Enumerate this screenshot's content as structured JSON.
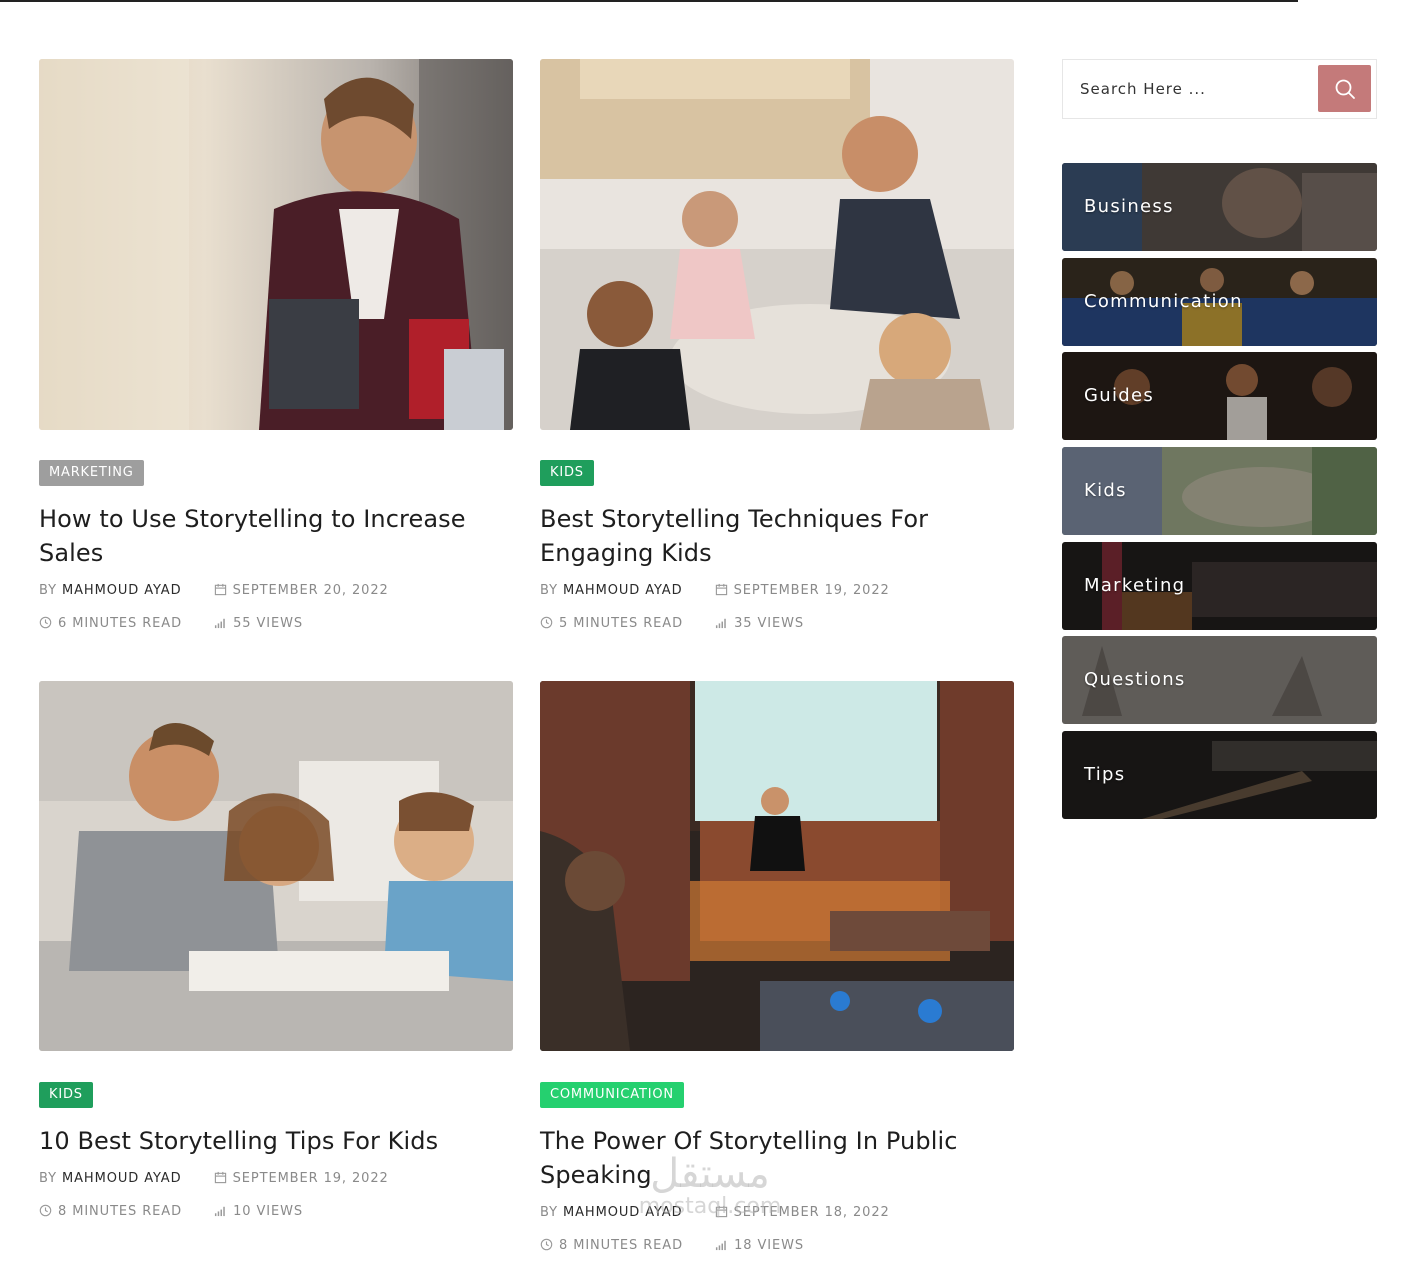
{
  "search": {
    "placeholder": "Search Here ..."
  },
  "colors": {
    "accent_search": "#c47a7a",
    "tag_marketing": "#9e9e9e",
    "tag_kids": "#1f9e5c",
    "tag_communication": "#25d06f"
  },
  "posts": [
    {
      "tag": "Marketing",
      "title": "How to Use Storytelling to Increase Sales",
      "author_prefix": "By",
      "author": "Mahmoud Ayad",
      "date": "September 20, 2022",
      "read_time": "6 Minutes Read",
      "views": "55 Views"
    },
    {
      "tag": "Kids",
      "title": "Best Storytelling Techniques For Engaging Kids",
      "author_prefix": "By",
      "author": "Mahmoud Ayad",
      "date": "September 19, 2022",
      "read_time": "5 Minutes Read",
      "views": "35 Views"
    },
    {
      "tag": "Kids",
      "title": "10 Best Storytelling Tips For Kids",
      "author_prefix": "By",
      "author": "Mahmoud Ayad",
      "date": "September 19, 2022",
      "read_time": "8 Minutes Read",
      "views": "10 Views"
    },
    {
      "tag": "Communication",
      "title": "The Power Of Storytelling In Public Speaking",
      "author_prefix": "By",
      "author": "Mahmoud Ayad",
      "date": "September 18, 2022",
      "read_time": "8 Minutes Read",
      "views": "18 Views"
    }
  ],
  "categories": [
    {
      "label": "Business"
    },
    {
      "label": "Communication"
    },
    {
      "label": "Guides"
    },
    {
      "label": "Kids"
    },
    {
      "label": "Marketing"
    },
    {
      "label": "Questions"
    },
    {
      "label": "Tips"
    }
  ],
  "watermark": {
    "arabic": "مستقل",
    "latin": "mostaql.com"
  }
}
